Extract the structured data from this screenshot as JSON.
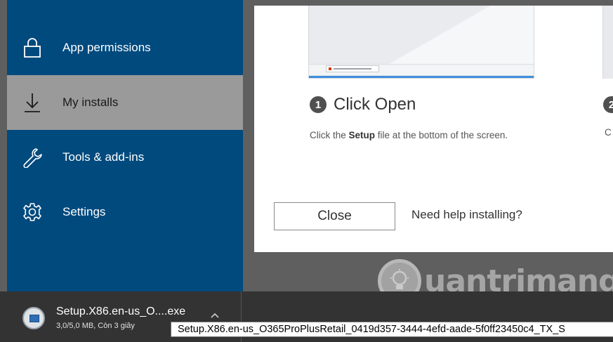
{
  "sidebar": {
    "items": [
      {
        "label": "App permissions",
        "icon": "lock-icon"
      },
      {
        "label": "My installs",
        "icon": "download-arrow-icon",
        "active": true
      },
      {
        "label": "Tools & add-ins",
        "icon": "wrench-icon"
      },
      {
        "label": "Settings",
        "icon": "gear-icon"
      }
    ]
  },
  "dialog": {
    "step": {
      "number": "1",
      "title": "Click Open",
      "desc_prefix": "Click the ",
      "desc_bold": "Setup",
      "desc_suffix": " file at the bottom of the screen."
    },
    "next_step_number": "2",
    "next_step_desc_fragment": "C",
    "close_label": "Close",
    "help_link": "Need help installing?"
  },
  "download_bar": {
    "file_name": "Setup.X86.en-us_O....exe",
    "status": "3,0/5,0 MB, Còn 3 giây",
    "tooltip": "Setup.X86.en-us_O365ProPlusRetail_0419d357-3444-4efd-aade-5f0ff23450c4_TX_S"
  },
  "watermark": {
    "text": "uantrimang",
    "icon": "lightbulb-icon"
  },
  "colors": {
    "nav_bg": "#004a7e",
    "nav_active": "#9a9a9a",
    "download_bar": "#333333",
    "progress_blue": "#3f8edb"
  }
}
